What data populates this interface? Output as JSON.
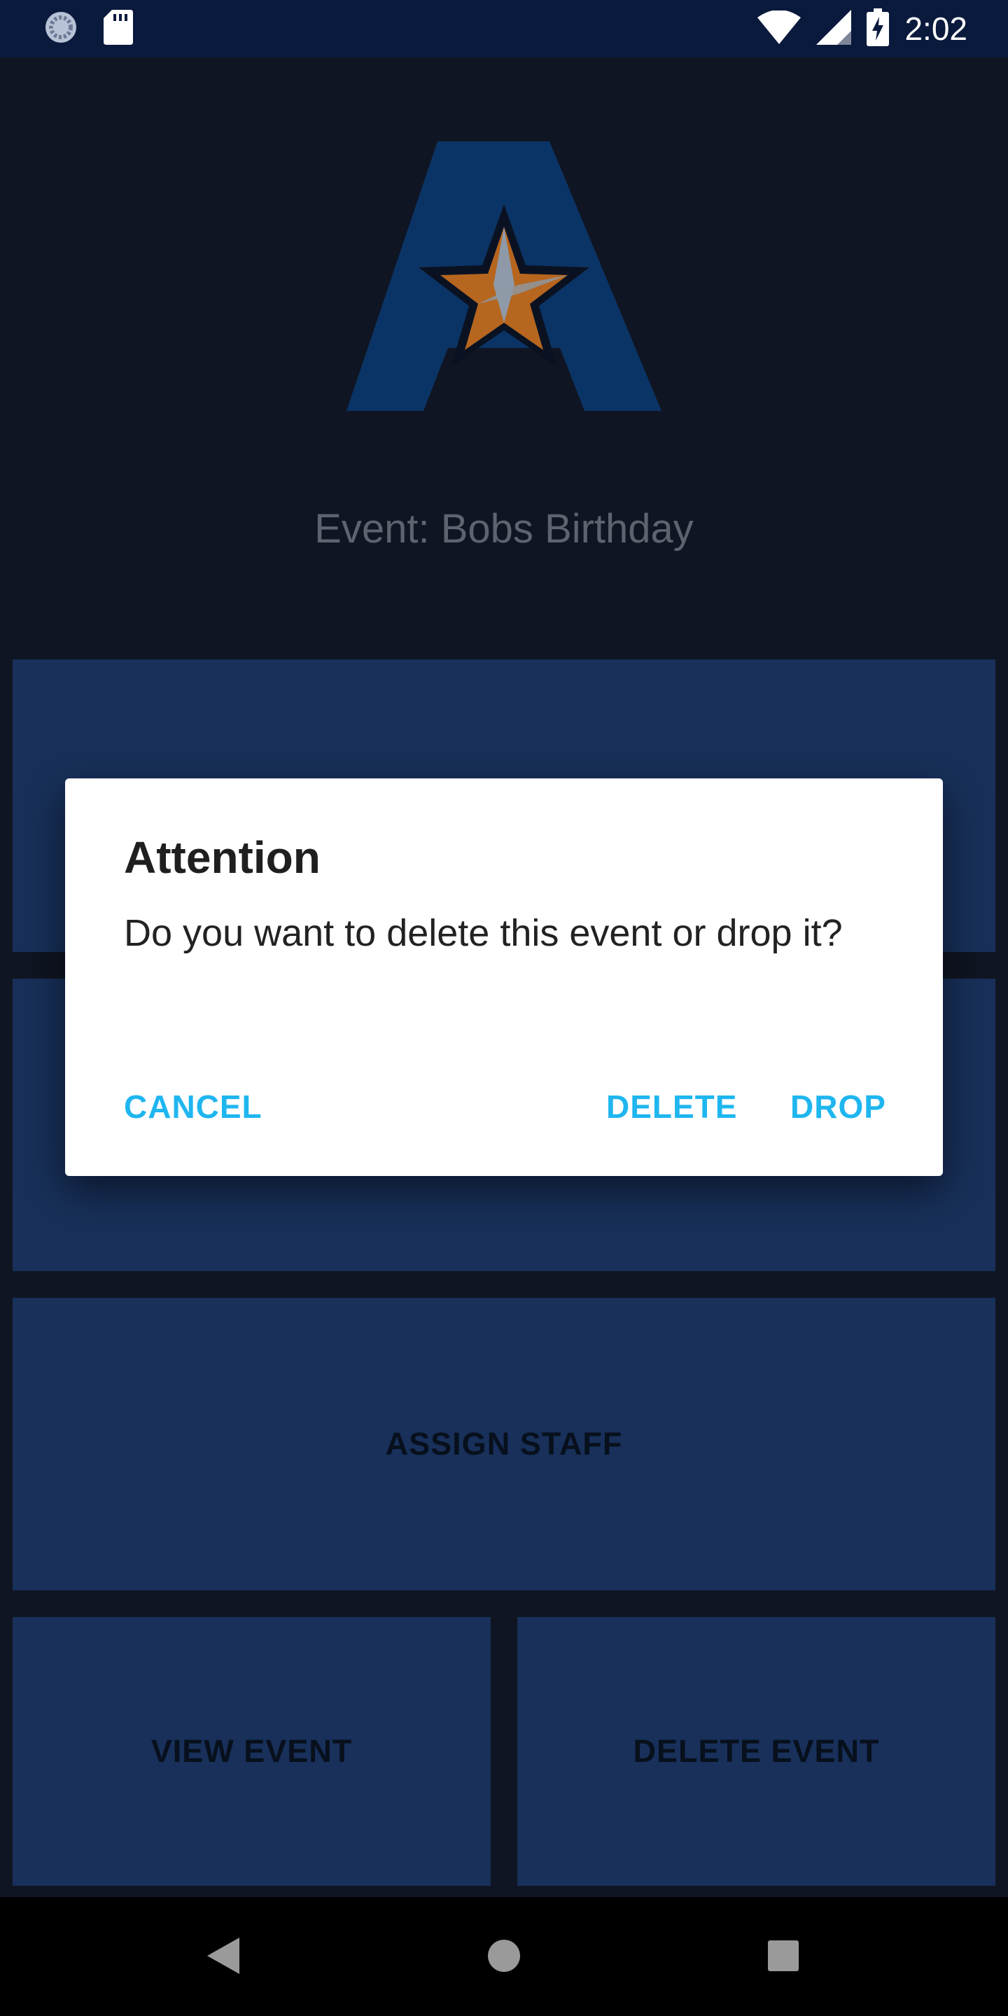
{
  "status_bar": {
    "time": "2:02",
    "icons": [
      "sync-icon",
      "sd-card-icon",
      "wifi-icon",
      "signal-icon",
      "battery-charging-icon"
    ]
  },
  "app": {
    "logo": "uta-star-logo",
    "event_title": "Event: Bobs Birthday",
    "tiles": {
      "assign_staff": "ASSIGN STAFF",
      "view_event": "VIEW EVENT",
      "delete_event": "DELETE EVENT"
    }
  },
  "dialog": {
    "title": "Attention",
    "message": "Do you want to delete this event or drop it?",
    "cancel_label": "CANCEL",
    "delete_label": "DELETE",
    "drop_label": "DROP"
  },
  "nav_bar": {
    "icons": [
      "back-icon",
      "home-icon",
      "recents-icon"
    ]
  },
  "colors": {
    "status_bar": "#0a1a3d",
    "tile": "#18305a",
    "dialog_accent": "#1fb6f0",
    "scrim": "#0f1522"
  }
}
